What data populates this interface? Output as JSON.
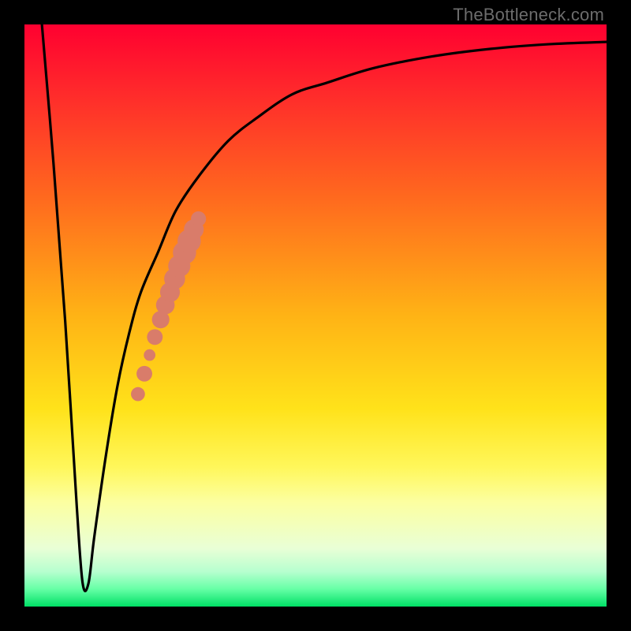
{
  "watermark": "TheBottleneck.com",
  "colors": {
    "frame": "#000000",
    "curve": "#000000",
    "markers": "#d97c6a",
    "gradient_top": "#ff0030",
    "gradient_bottom": "#00e066"
  },
  "chart_data": {
    "type": "line",
    "title": "",
    "xlabel": "",
    "ylabel": "",
    "xlim": [
      0,
      100
    ],
    "ylim": [
      0,
      100
    ],
    "grid": false,
    "legend": false,
    "notes": "Axes have no printed tick labels; values are inferred on a 0–100 scale from plot geometry. The curve drops sharply from top-left to a minimum near x≈10, then rises steeply and asymptotically flattens near the top. A cluster of salmon-colored dots lies along the rising limb.",
    "series": [
      {
        "name": "curve",
        "x": [
          3,
          5,
          7,
          9,
          10,
          11,
          12,
          14,
          16,
          18,
          20,
          23,
          26,
          30,
          35,
          40,
          46,
          52,
          60,
          70,
          80,
          90,
          100
        ],
        "y": [
          100,
          76,
          49,
          17,
          4,
          4,
          12,
          26,
          38,
          47,
          54,
          61,
          68,
          74,
          80,
          84,
          88,
          90,
          92.5,
          94.5,
          95.8,
          96.6,
          97
        ]
      }
    ],
    "markers": [
      {
        "x": 19.5,
        "y": 36.5,
        "r": 1.2
      },
      {
        "x": 20.6,
        "y": 40.0,
        "r": 1.35
      },
      {
        "x": 21.5,
        "y": 43.2,
        "r": 1.0
      },
      {
        "x": 22.4,
        "y": 46.3,
        "r": 1.35
      },
      {
        "x": 23.4,
        "y": 49.3,
        "r": 1.5
      },
      {
        "x": 24.2,
        "y": 51.8,
        "r": 1.6
      },
      {
        "x": 25.0,
        "y": 54.0,
        "r": 1.7
      },
      {
        "x": 25.8,
        "y": 56.3,
        "r": 1.8
      },
      {
        "x": 26.6,
        "y": 58.5,
        "r": 1.9
      },
      {
        "x": 27.5,
        "y": 60.8,
        "r": 2.0
      },
      {
        "x": 28.3,
        "y": 62.8,
        "r": 2.0
      },
      {
        "x": 29.1,
        "y": 64.8,
        "r": 1.7
      },
      {
        "x": 29.9,
        "y": 66.6,
        "r": 1.3
      }
    ]
  }
}
